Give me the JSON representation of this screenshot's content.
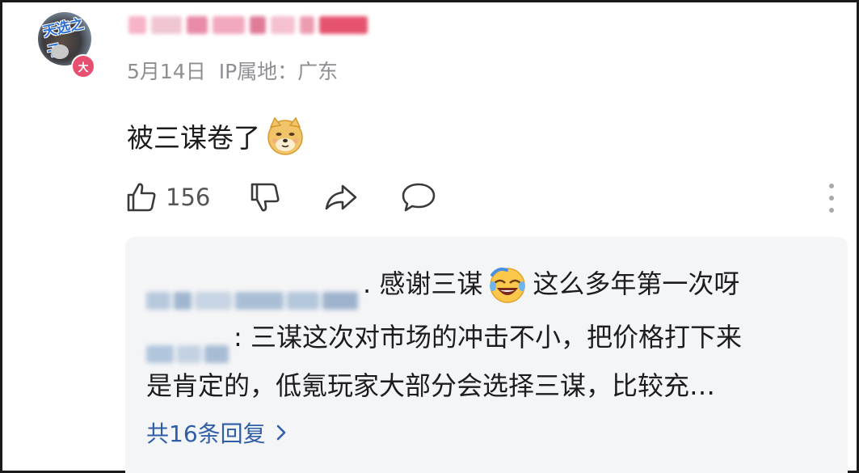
{
  "comment": {
    "avatar": {
      "sticker_text": "天选之子",
      "level_badge": "大"
    },
    "date": "5月14日",
    "ip_location": "IP属地：广东",
    "text": "被三谋卷了",
    "emoji": "doge-emoji",
    "actions": {
      "like_icon": "thumbs-up-icon",
      "like_count": "156",
      "dislike_icon": "thumbs-down-icon",
      "share_icon": "share-icon",
      "reply_icon": "comment-icon",
      "more_icon": "more-vertical-icon"
    }
  },
  "replies": {
    "items": [
      {
        "text_before_emoji": ". 感谢三谋",
        "emoji": "laugh-cry-emoji",
        "text_after_emoji": "这么多年第一次呀"
      },
      {
        "line1": ": 三谋这次对市场的冲击不小，把价格打下来",
        "line2": "是肯定的，低氪玩家大部分会选择三谋，比较充…"
      }
    ],
    "more_label": "共16条回复",
    "more_icon": "chevron-right-icon"
  },
  "colors": {
    "link_blue": "#2f5da7",
    "meta_gray": "#8e8e93",
    "reply_bg": "#f4f5f7",
    "badge_pink": "#e84e6f"
  }
}
